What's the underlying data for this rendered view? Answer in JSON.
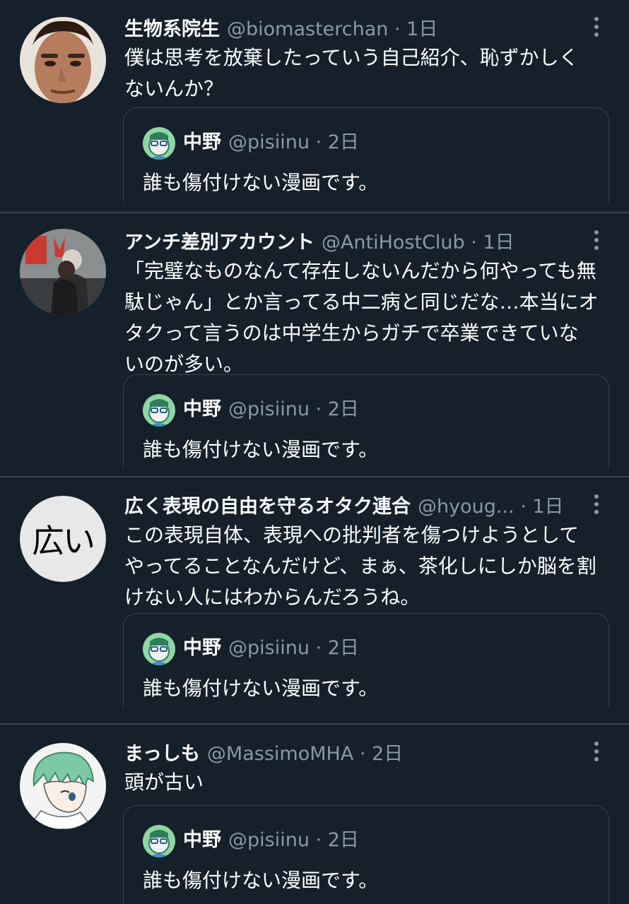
{
  "colors": {
    "background": "#15202b",
    "text": "#ffffff",
    "secondary": "#8899a6",
    "border": "#38444d"
  },
  "quoted": {
    "name": "中野",
    "handle": "@pisiinu",
    "dot": " · ",
    "time": "2日",
    "text": "誰も傷付けない漫画です。",
    "avatar_icon": "cartoon-face-avatar"
  },
  "tweets": [
    {
      "name": "生物系院生",
      "handle": "@biomasterchan",
      "dot": " · ",
      "time": "1日",
      "lines": [
        "僕は思考を放棄したっていう自己紹介、恥ずかしく",
        "ないんか？"
      ],
      "avatar_icon": "man-photo-avatar"
    },
    {
      "name": "アンチ差別アカウント",
      "handle": "@AntiHostClub",
      "dot": " · ",
      "time": "1日",
      "lines": [
        "「完璧なものなんて存在しないんだから何やっても無",
        "駄じゃん」とか言ってる中二病と同じだな…本当にオ",
        "タクって言うのは中学生からガチで卒業できていな",
        "いのが多い。"
      ],
      "avatar_icon": "photo-avatar"
    },
    {
      "name": "広く表現の自由を守るオタク連合",
      "handle": "@hyoug...",
      "dot": " · ",
      "time": "1日",
      "lines": [
        "この表現自体、表現への批判者を傷つけようとして",
        "やってることなんだけど、まぁ、茶化しにしか脳を割",
        "けない人にはわからんだろうね。"
      ],
      "avatar_text": "広い"
    },
    {
      "name": "まっしも",
      "handle": "@MassimoMHA",
      "dot": " · ",
      "time": "2日",
      "lines": [
        "頭が古い"
      ],
      "avatar_icon": "anime-character-avatar"
    }
  ]
}
